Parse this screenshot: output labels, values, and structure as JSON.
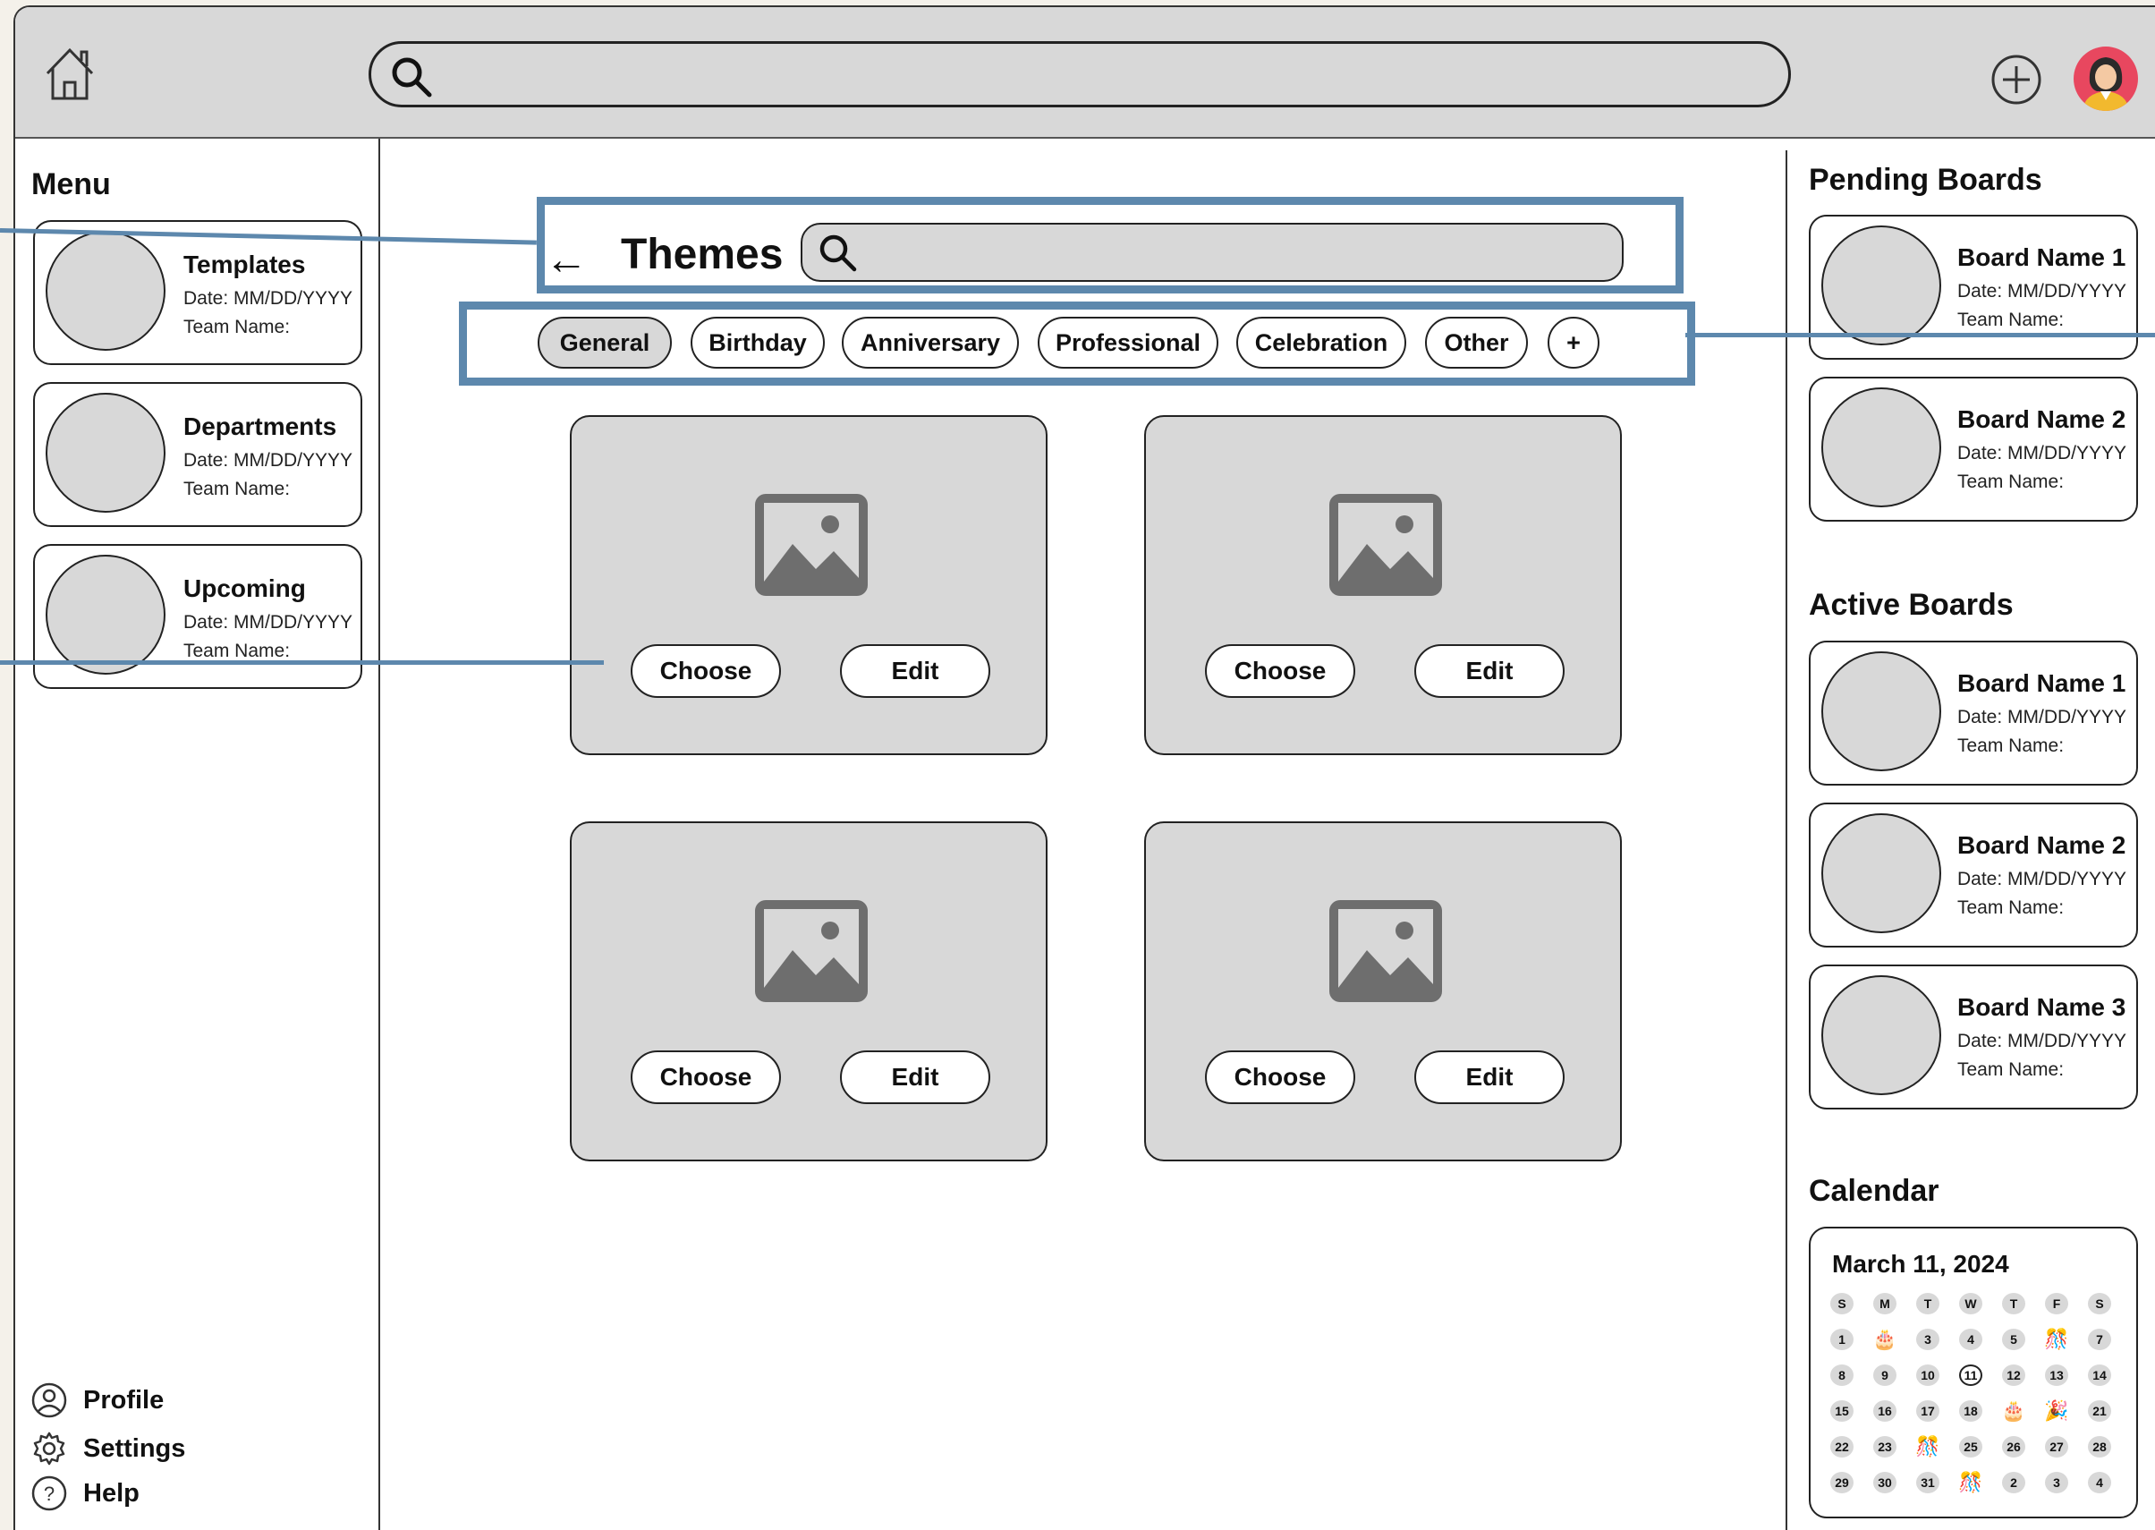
{
  "colors": {
    "highlight": "#5d88ad",
    "panel_gray": "#d8d8d8",
    "avatar_bg": "#e8475f"
  },
  "topbar": {
    "icons": [
      "home-icon",
      "search-icon",
      "plus-circle-icon",
      "avatar"
    ]
  },
  "sidebar": {
    "title": "Menu",
    "items": [
      {
        "title": "Templates",
        "date": "Date: MM/DD/YYYY",
        "team": "Team Name:"
      },
      {
        "title": "Departments",
        "date": "Date: MM/DD/YYYY",
        "team": "Team Name:"
      },
      {
        "title": "Upcoming",
        "date": "Date: MM/DD/YYYY",
        "team": "Team Name:"
      }
    ],
    "bottom": [
      {
        "label": "Profile",
        "icon": "user-icon"
      },
      {
        "label": "Settings",
        "icon": "gear-icon"
      },
      {
        "label": "Help",
        "icon": "help-icon"
      }
    ]
  },
  "main": {
    "back": "←",
    "title": "Themes",
    "categories": [
      "General",
      "Birthday",
      "Anniversary",
      "Professional",
      "Celebration",
      "Other",
      "+"
    ],
    "active_category": "General",
    "cards": [
      {
        "choose": "Choose",
        "edit": "Edit"
      },
      {
        "choose": "Choose",
        "edit": "Edit"
      },
      {
        "choose": "Choose",
        "edit": "Edit"
      },
      {
        "choose": "Choose",
        "edit": "Edit"
      }
    ]
  },
  "rightbar": {
    "pending_title": "Pending Boards",
    "pending": [
      {
        "title": "Board Name 1",
        "date": "Date: MM/DD/YYYY",
        "team": "Team Name:"
      },
      {
        "title": "Board Name 2",
        "date": "Date: MM/DD/YYYY",
        "team": "Team Name:"
      }
    ],
    "active_title": "Active Boards",
    "active": [
      {
        "title": "Board Name 1",
        "date": "Date: MM/DD/YYYY",
        "team": "Team Name:"
      },
      {
        "title": "Board Name 2",
        "date": "Date: MM/DD/YYYY",
        "team": "Team Name:"
      },
      {
        "title": "Board Name 3",
        "date": "Date: MM/DD/YYYY",
        "team": "Team Name:"
      }
    ],
    "calendar_title": "Calendar",
    "calendar": {
      "month_label": "March 11, 2024",
      "weekdays": [
        "S",
        "M",
        "T",
        "W",
        "T",
        "F",
        "S"
      ],
      "days": [
        "1",
        "🎂",
        "3",
        "4",
        "5",
        "🎊",
        "7",
        "8",
        "9",
        "10",
        "11",
        "12",
        "13",
        "14",
        "15",
        "16",
        "17",
        "18",
        "🎂",
        "🎉",
        "21",
        "22",
        "23",
        "🎊",
        "25",
        "26",
        "27",
        "28",
        "29",
        "30",
        "31",
        "🎊",
        "2",
        "3",
        "4"
      ],
      "today": "11"
    }
  }
}
